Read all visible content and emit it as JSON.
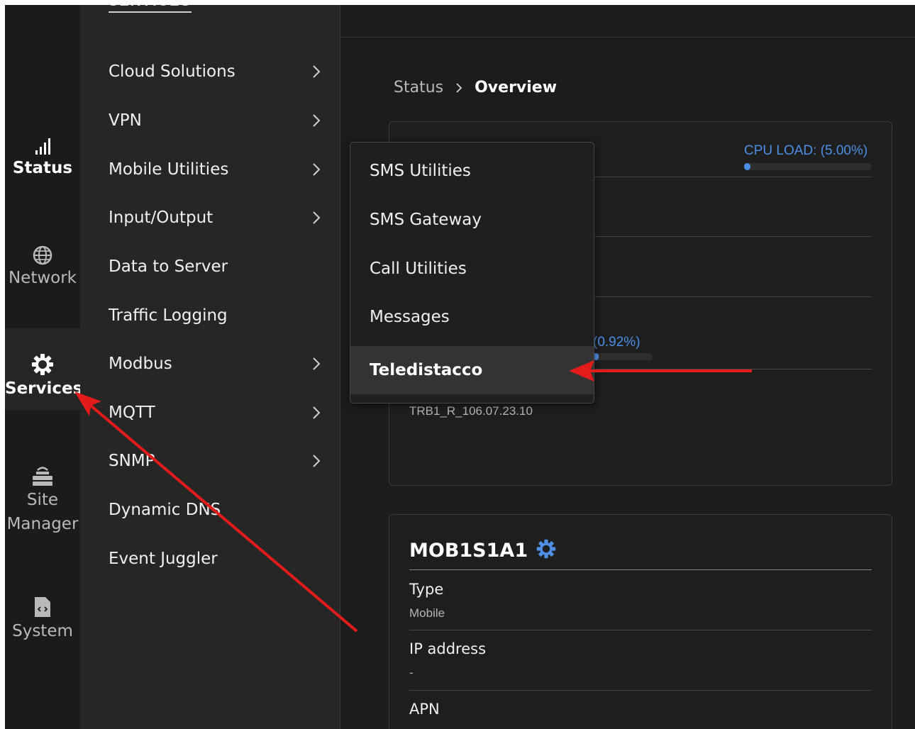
{
  "rail": {
    "status_label": "Status",
    "network_label": "Network",
    "services_label": "Services",
    "site_label_1": "Site",
    "site_label_2": "Manager",
    "system_label": "System"
  },
  "submenu": {
    "header": "SERVICES",
    "items": [
      {
        "label": "Cloud Solutions"
      },
      {
        "label": "VPN"
      },
      {
        "label": "Mobile Utilities"
      },
      {
        "label": "Input/Output"
      },
      {
        "label": "Data to Server"
      },
      {
        "label": "Traffic Logging"
      },
      {
        "label": "Modbus"
      },
      {
        "label": "MQTT"
      },
      {
        "label": "SNMP"
      },
      {
        "label": "Dynamic DNS"
      },
      {
        "label": "Event Juggler"
      }
    ]
  },
  "breadcrumb": {
    "parent": "Status",
    "current": "Overview"
  },
  "system_card": {
    "cpu_label": "CPU LOAD: (5.00%)",
    "cpu_load_fraction": 0.05,
    "ram_label": "(0.92%)",
    "ram_fraction": 0.0092,
    "firmware": "TRB1_R_106.07.23.10"
  },
  "mobile_card": {
    "title": "MOB1S1A1",
    "type_label": "Type",
    "type_value": "Mobile",
    "ip_label": "IP address",
    "ip_value": "-",
    "apn_label": "APN"
  },
  "dropdown": {
    "items": [
      {
        "label": "SMS Utilities"
      },
      {
        "label": "SMS Gateway"
      },
      {
        "label": "Call Utilities"
      },
      {
        "label": "Messages"
      },
      {
        "label": "Teledistacco"
      }
    ]
  },
  "colors": {
    "accent": "#4d8fe6",
    "annotation_arrow": "#e31b1b",
    "background": "#1c1c1c",
    "submenu_bg": "#262626"
  }
}
